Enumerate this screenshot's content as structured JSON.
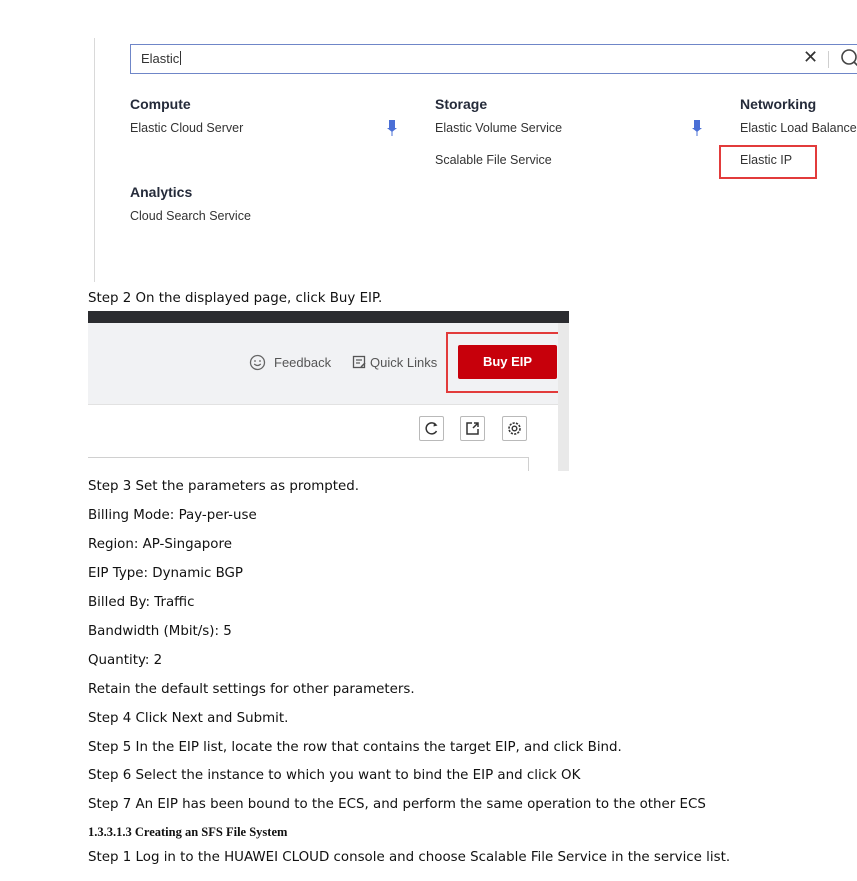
{
  "service_search": {
    "query": "Elastic",
    "clear_icon": "close-icon",
    "search_icon": "search-icon",
    "categories": [
      {
        "name": "Compute",
        "services": [
          "Elastic Cloud Server"
        ]
      },
      {
        "name": "Storage",
        "services": [
          "Elastic Volume Service",
          "Scalable File Service"
        ]
      },
      {
        "name": "Networking",
        "services": [
          "Elastic Load Balance",
          "Elastic IP"
        ]
      },
      {
        "name": "Analytics",
        "services": [
          "Cloud Search Service"
        ]
      }
    ],
    "highlight_color": "#e23b3b",
    "pin_color": "#4a6fd6"
  },
  "steps_a": {
    "step2": "Step 2 On the displayed page, click Buy EIP."
  },
  "eip_page": {
    "feedback": "Feedback",
    "quick_links": "Quick Links",
    "buy_button": "Buy EIP",
    "buy_color": "#c7000b",
    "icons": [
      "refresh-icon",
      "export-icon",
      "settings-icon"
    ]
  },
  "steps_b": {
    "lines": [
      "Step 3 Set the parameters as prompted.",
      "Billing Mode: Pay-per-use",
      "Region: AP-Singapore",
      "EIP Type: Dynamic BGP",
      "Billed By: Traffic",
      "Bandwidth (Mbit/s): 5",
      "Quantity: 2",
      "Retain the default settings for other parameters.",
      "Step 4 Click Next and Submit.",
      "Step 5 In the EIP list, locate the row that contains the target EIP, and click Bind.",
      "Step 6 Select the instance to which you want to bind the EIP and click OK",
      "Step 7 An EIP has been bound to the ECS, and perform the same operation to the other ECS"
    ],
    "section_heading": "1.3.3.1.3 Creating an SFS File System",
    "final_step": "Step 1 Log in to the HUAWEI CLOUD console and choose Scalable File Service in the service list."
  }
}
